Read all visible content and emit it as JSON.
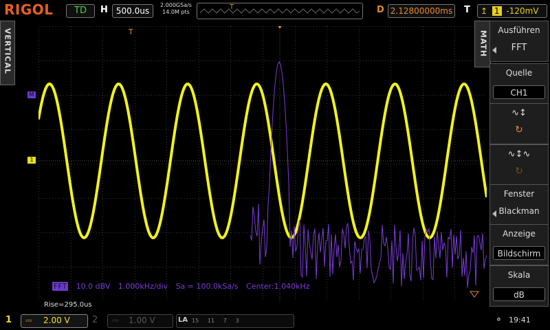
{
  "header": {
    "brand": "RIGOL",
    "mode": "TD",
    "horizontal_label": "H",
    "timebase": "500.0us",
    "sample_rate": "2.000GSa/s",
    "memory_depth": "14.0M pts",
    "delay_label": "D",
    "delay_value": "2.12800000ms",
    "trigger_label": "T",
    "trigger_source": "1",
    "trigger_level": "-120mV"
  },
  "left_tab": {
    "label": "VERTICAL"
  },
  "markers": {
    "math": "M",
    "ch1": "1"
  },
  "fft_info": {
    "badge": "FFT",
    "scale": "10.0 dBV",
    "span": "1.000kHz/div",
    "sample": "Sa = 100.0kSa/s",
    "center": "Center:1.040kHz"
  },
  "rise_measure": "Rise=295.0us",
  "menu": {
    "tab": "MATH",
    "items": [
      {
        "label": "Ausführen",
        "value": "FFT"
      },
      {
        "label": "Quelle",
        "value": "CH1"
      },
      {
        "label": "",
        "value": ""
      },
      {
        "label": "",
        "value": ""
      },
      {
        "label": "Fenster",
        "value": "Blackman"
      },
      {
        "label": "Anzeige",
        "value": "Bildschirm"
      },
      {
        "label": "Skala",
        "value": "dB"
      }
    ]
  },
  "footer": {
    "ch1_num": "1",
    "ch1_scale": "2.00 V",
    "ch2_num": "2",
    "ch2_scale": "1.00 V",
    "la_label": "LA",
    "la_channels": "15     11     7     3",
    "clock": "19:41"
  },
  "colors": {
    "ch1": "#f2f21a",
    "math": "#7a3cd8",
    "accent": "#e6601e"
  }
}
